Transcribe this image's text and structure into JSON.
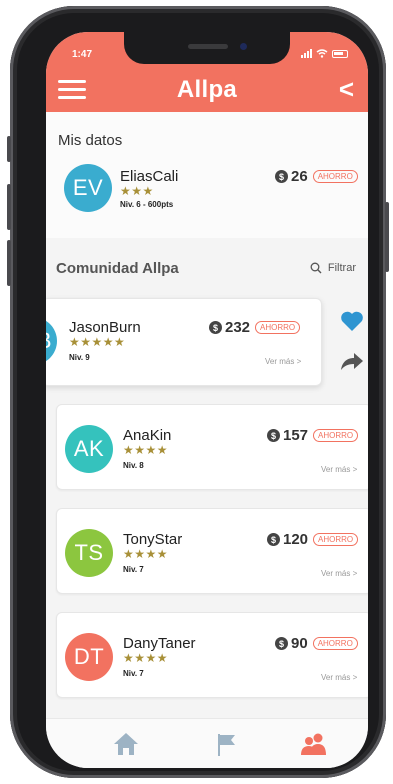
{
  "status_bar": {
    "time": "1:47"
  },
  "header": {
    "title": "Allpa",
    "back_label": "<"
  },
  "mis_datos": {
    "title": "Mis datos",
    "user": {
      "initials": "EV",
      "name": "EliasCali",
      "stars": "★★★",
      "level": "Niv. 6 - 600pts",
      "amount": "26",
      "badge": "AHORRO",
      "avatar_color": "#3aaccf"
    }
  },
  "community": {
    "title": "Comunidad Allpa",
    "filter_label": "Filtrar",
    "more_label": "Ver más >",
    "members": [
      {
        "initials": "B",
        "name": "JasonBurn",
        "stars": "★★★★★",
        "level": "Niv. 9",
        "amount": "232",
        "badge": "AHORRO",
        "avatar_color": "#3aaccf"
      },
      {
        "initials": "AK",
        "name": "AnaKin",
        "stars": "★★★★",
        "level": "Niv. 8",
        "amount": "157",
        "badge": "AHORRO",
        "avatar_color": "#35c2bd"
      },
      {
        "initials": "TS",
        "name": "TonyStar",
        "stars": "★★★★",
        "level": "Niv. 7",
        "amount": "120",
        "badge": "AHORRO",
        "avatar_color": "#8cc63f"
      },
      {
        "initials": "DT",
        "name": "DanyTaner",
        "stars": "★★★★",
        "level": "Niv. 7",
        "amount": "90",
        "badge": "AHORRO",
        "avatar_color": "#f27260"
      }
    ]
  },
  "icons": {
    "home": "home-icon",
    "flag": "flag-icon",
    "people": "people-icon",
    "heart": "heart-icon",
    "share": "share-icon",
    "search": "search-icon"
  },
  "colors": {
    "accent": "#f27260",
    "star": "#a89038",
    "heart": "#2f95d1",
    "nav_inactive": "#9db3c4"
  }
}
